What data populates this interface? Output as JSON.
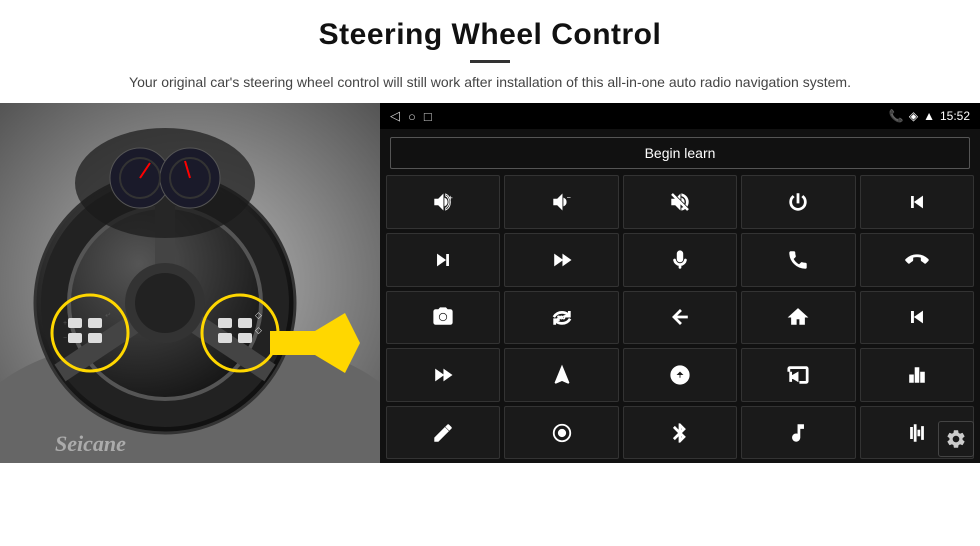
{
  "header": {
    "title": "Steering Wheel Control",
    "divider": true,
    "description": "Your original car's steering wheel control will still work after installation of this all-in-one auto radio navigation system."
  },
  "status_bar": {
    "time": "15:52",
    "nav_icons": [
      "◁",
      "○",
      "□"
    ]
  },
  "begin_learn": {
    "label": "Begin learn"
  },
  "watermark": {
    "text": "Seicane"
  },
  "gear_icon_label": "gear-icon",
  "grid": {
    "rows": [
      [
        {
          "icon": "vol_up",
          "unicode": "🔊+"
        },
        {
          "icon": "vol_down",
          "unicode": "🔉−"
        },
        {
          "icon": "vol_mute",
          "unicode": "🔇"
        },
        {
          "icon": "power",
          "unicode": "⏻"
        },
        {
          "icon": "prev_track",
          "unicode": "⏮"
        }
      ],
      [
        {
          "icon": "next",
          "unicode": "⏭"
        },
        {
          "icon": "skip_fwd",
          "unicode": "⏭⏭"
        },
        {
          "icon": "mic",
          "unicode": "🎙"
        },
        {
          "icon": "phone",
          "unicode": "📞"
        },
        {
          "icon": "hang_up",
          "unicode": "📵"
        }
      ],
      [
        {
          "icon": "camera",
          "unicode": "📷"
        },
        {
          "icon": "360",
          "unicode": "360°"
        },
        {
          "icon": "back",
          "unicode": "↩"
        },
        {
          "icon": "home",
          "unicode": "⌂"
        },
        {
          "icon": "skip_back",
          "unicode": "⏮⏮"
        }
      ],
      [
        {
          "icon": "fast_fwd",
          "unicode": "⏭⏭"
        },
        {
          "icon": "navigate",
          "unicode": "◆"
        },
        {
          "icon": "swap",
          "unicode": "⇄"
        },
        {
          "icon": "media",
          "unicode": "📺"
        },
        {
          "icon": "equalizer",
          "unicode": "⚙"
        }
      ],
      [
        {
          "icon": "edit",
          "unicode": "✏"
        },
        {
          "icon": "circle_power",
          "unicode": "⊙"
        },
        {
          "icon": "bluetooth",
          "unicode": "⚡"
        },
        {
          "icon": "music",
          "unicode": "♪"
        },
        {
          "icon": "sound_wave",
          "unicode": "📊"
        }
      ]
    ]
  }
}
